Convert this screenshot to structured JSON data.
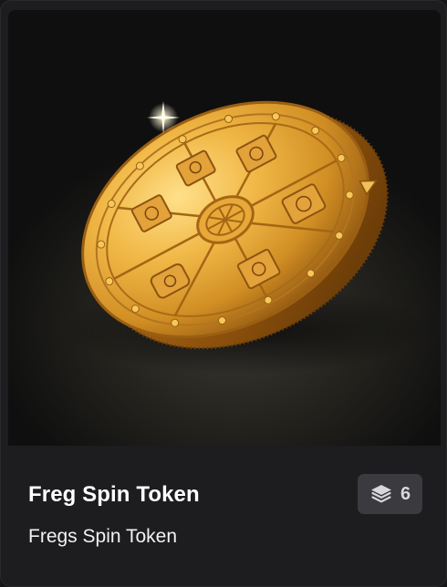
{
  "card": {
    "title": "Freg Spin Token",
    "subtitle": "Fregs Spin Token",
    "count": "6",
    "count_icon": "layers-icon",
    "image_icon": "gold-coin-token-image"
  },
  "colors": {
    "background": "#1d1d1f",
    "badge_bg": "#3b3b3f",
    "coin_gold": "#e0a23a"
  }
}
